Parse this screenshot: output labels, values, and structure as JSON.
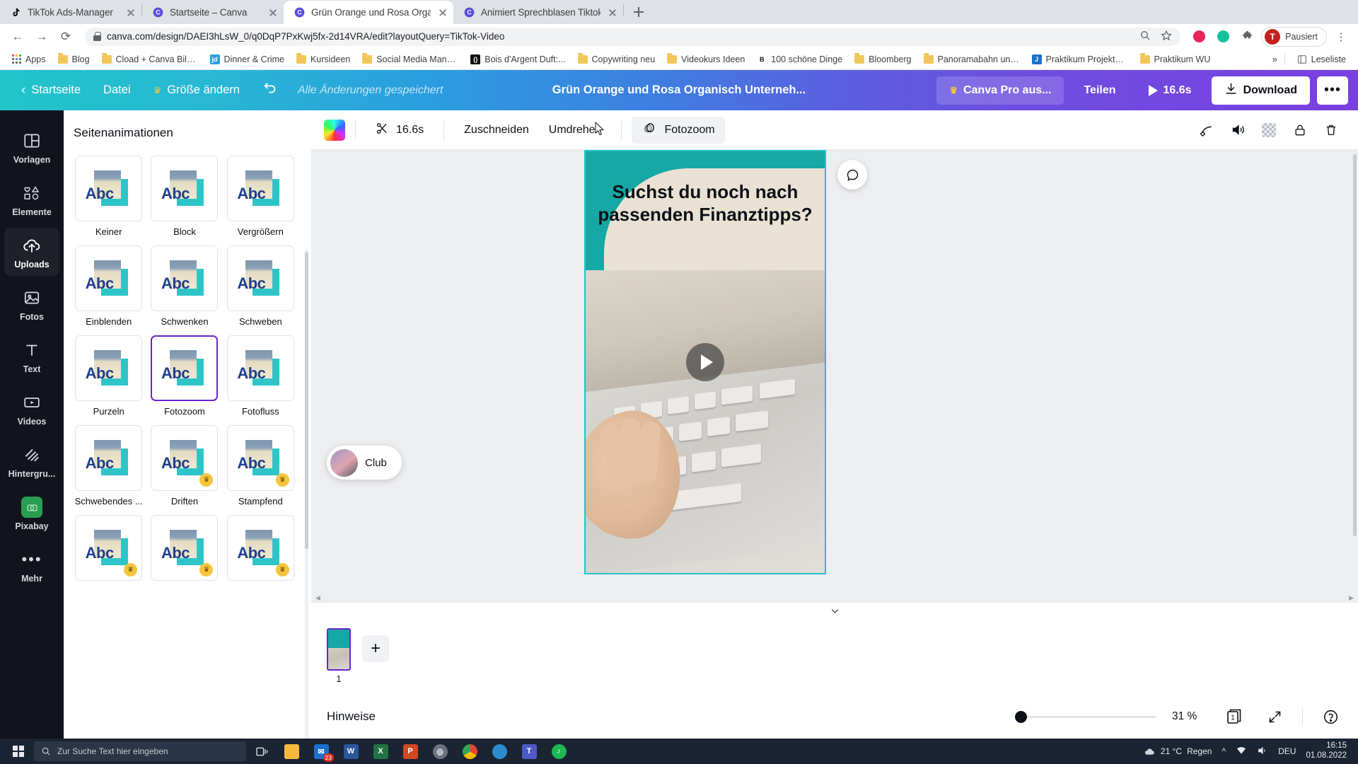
{
  "browser": {
    "tabs": [
      {
        "title": "TikTok Ads-Manager",
        "favicon": "tiktok-icon",
        "active": false
      },
      {
        "title": "Startseite – Canva",
        "favicon": "canva-icon",
        "active": false
      },
      {
        "title": "Grün Orange und Rosa Organisc",
        "favicon": "canva-icon",
        "active": true
      },
      {
        "title": "Animiert Sprechblasen Tiktok-Hi",
        "favicon": "canva-icon",
        "active": false
      }
    ],
    "new_tab_label": "+",
    "nav": {
      "back": "←",
      "forward": "→",
      "reload": "⟳"
    },
    "url": "canva.com/design/DAEI3hLsW_0/q0DqP7PxKwj5fx-2d14VRA/edit?layoutQuery=TikTok-Video",
    "omni_icons": [
      "zoom-icon",
      "star-icon"
    ],
    "extensions": [
      "extension-red-icon",
      "grammarly-icon",
      "extension-puzzle-icon"
    ],
    "profile": {
      "initial": "T",
      "label": "Pausiert"
    },
    "menu_icon": "kebab-icon",
    "bookmarks": [
      {
        "label": "Apps",
        "icon": "apps-grid-icon"
      },
      {
        "label": "Blog",
        "icon": "folder-icon"
      },
      {
        "label": "Cload + Canva Bilder",
        "icon": "folder-icon"
      },
      {
        "label": "Dinner & Crime",
        "icon": "site-icon",
        "color": "#29a3dc",
        "glyph": "jd"
      },
      {
        "label": "Kursideen",
        "icon": "folder-icon"
      },
      {
        "label": "Social Media Mana...",
        "icon": "folder-icon"
      },
      {
        "label": "Bois d'Argent Duft:...",
        "icon": "site-icon",
        "color": "#111111",
        "glyph": "()"
      },
      {
        "label": "Copywriting neu",
        "icon": "folder-icon"
      },
      {
        "label": "Videokurs Ideen",
        "icon": "folder-icon"
      },
      {
        "label": "100 schöne Dinge",
        "icon": "site-icon",
        "color": "#ffffff",
        "glyph": "B"
      },
      {
        "label": "Bloomberg",
        "icon": "folder-icon"
      },
      {
        "label": "Panoramabahn und...",
        "icon": "folder-icon"
      },
      {
        "label": "Praktikum Projektm...",
        "icon": "site-icon",
        "color": "#1a73c8",
        "glyph": "J"
      },
      {
        "label": "Praktikum WU",
        "icon": "folder-icon"
      }
    ],
    "bookmarks_overflow": "»",
    "reading_list": "Leseliste"
  },
  "canva_header": {
    "back_icon": "chevron-left-icon",
    "home": "Startseite",
    "file": "Datei",
    "resize": "Größe ändern",
    "undo_icon": "undo-icon",
    "saved_status": "Alle Änderungen gespeichert",
    "design_title": "Grün Orange und Rosa Organisch Unterneh...",
    "pro_label": "Canva Pro aus...",
    "share": "Teilen",
    "duration": "16.6s",
    "download": "Download",
    "more": "•••"
  },
  "rail": {
    "items": [
      {
        "label": "Vorlagen",
        "icon": "templates-icon",
        "active": false
      },
      {
        "label": "Elemente",
        "icon": "elements-icon",
        "active": false
      },
      {
        "label": "Uploads",
        "icon": "upload-cloud-icon",
        "active": true
      },
      {
        "label": "Fotos",
        "icon": "photo-icon",
        "active": false
      },
      {
        "label": "Text",
        "icon": "text-icon",
        "active": false
      },
      {
        "label": "Videos",
        "icon": "video-icon",
        "active": false
      },
      {
        "label": "Hintergru...",
        "icon": "background-icon",
        "active": false
      },
      {
        "label": "Pixabay",
        "icon": "pixabay-icon",
        "active": false
      },
      {
        "label": "Mehr",
        "icon": "more-dots-icon",
        "active": false
      }
    ]
  },
  "panel": {
    "title": "Seitenanimationen",
    "animations": [
      {
        "label": "Keiner",
        "pro": false,
        "selected": false
      },
      {
        "label": "Block",
        "pro": false,
        "selected": false
      },
      {
        "label": "Vergrößern",
        "pro": false,
        "selected": false
      },
      {
        "label": "Einblenden",
        "pro": false,
        "selected": false
      },
      {
        "label": "Schwenken",
        "pro": false,
        "selected": false
      },
      {
        "label": "Schweben",
        "pro": false,
        "selected": false
      },
      {
        "label": "Purzeln",
        "pro": false,
        "selected": false
      },
      {
        "label": "Fotozoom",
        "pro": false,
        "selected": true
      },
      {
        "label": "Fotofluss",
        "pro": false,
        "selected": false
      },
      {
        "label": "Schwebendes ...",
        "pro": false,
        "selected": false
      },
      {
        "label": "Driften",
        "pro": true,
        "selected": false
      },
      {
        "label": "Stampfend",
        "pro": true,
        "selected": false
      },
      {
        "label": "",
        "pro": true,
        "selected": false
      },
      {
        "label": "",
        "pro": true,
        "selected": false
      },
      {
        "label": "",
        "pro": true,
        "selected": false
      }
    ]
  },
  "editor_toolbar": {
    "color_swatch": "rainbow-swatch",
    "scissors_icon": "scissors-icon",
    "duration": "16.6s",
    "crop": "Zuschneiden",
    "flip": "Umdrehen",
    "photozoom": "Fotozoom",
    "photozoom_icon": "photozoom-icon",
    "right_icons": [
      "animate-icon",
      "volume-icon",
      "transparency-icon",
      "lock-icon",
      "trash-icon"
    ]
  },
  "canvas": {
    "headline": "Suchst du noch nach passenden Finanztipps?",
    "play_icon": "play-icon",
    "comment_icon": "comment-icon",
    "club_chip": "Club"
  },
  "pagestrip": {
    "collapse_icon": "chevron-down-icon",
    "page_number": "1",
    "add_label": "+"
  },
  "statusbar": {
    "notes_label": "Hinweise",
    "zoom_percent": "31 %",
    "page_count": "1",
    "fullscreen_icon": "expand-icon",
    "help_icon": "help-icon"
  },
  "taskbar": {
    "start_icon": "windows-icon",
    "search_placeholder": "Zur Suche Text hier eingeben",
    "search_icon": "search-icon",
    "apps": [
      {
        "name": "task-view",
        "glyph": "",
        "color": "transparent"
      },
      {
        "name": "file-explorer",
        "glyph": "",
        "color": "#f6b93b"
      },
      {
        "name": "mail",
        "glyph": "",
        "color": "#0a66c2",
        "badge": "23"
      },
      {
        "name": "word",
        "glyph": "W",
        "color": "#2b579a"
      },
      {
        "name": "excel",
        "glyph": "X",
        "color": "#217346"
      },
      {
        "name": "powerpoint",
        "glyph": "P",
        "color": "#d24726"
      },
      {
        "name": "disc",
        "glyph": "",
        "color": "#555e6b"
      },
      {
        "name": "chrome",
        "glyph": "",
        "color": "#34a853"
      },
      {
        "name": "edge",
        "glyph": "",
        "color": "#2d8ccd"
      },
      {
        "name": "teams",
        "glyph": "",
        "color": "#5059c9"
      },
      {
        "name": "spotify",
        "glyph": "",
        "color": "#1db954"
      }
    ],
    "weather": {
      "temp": "21 °C",
      "condition": "Regen"
    },
    "language": "DEU",
    "clock_time": "16:15",
    "clock_date": "01.08.2022",
    "tray_icons": [
      "cloud-icon",
      "chevron-up-icon",
      "wifi-icon",
      "speaker-icon"
    ]
  }
}
